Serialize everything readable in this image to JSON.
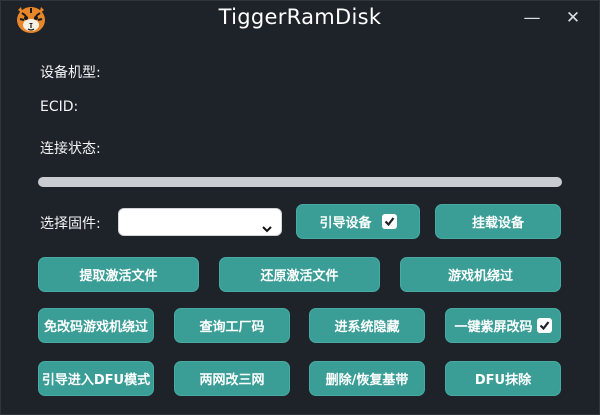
{
  "window": {
    "title": "TiggerRamDisk",
    "minimize_glyph": "—",
    "close_glyph": "✕"
  },
  "device": {
    "model_label": "设备机型:",
    "ecid_label": "ECID:",
    "status_label": "连接状态:"
  },
  "progress": {
    "value": 0
  },
  "firmware": {
    "label": "选择固件:",
    "selected": ""
  },
  "buttons": {
    "boot_device": {
      "label": "引导设备",
      "checked": true
    },
    "mount_device": {
      "label": "挂载设备"
    },
    "extract_activation": {
      "label": "提取激活文件"
    },
    "restore_activation": {
      "label": "还原激活文件"
    },
    "gaming_bypass": {
      "label": "游戏机绕过"
    },
    "no_code_gaming_bypass": {
      "label": "免改码游戏机绕过"
    },
    "query_factory_code": {
      "label": "查询工厂码"
    },
    "system_hide": {
      "label": "进系统隐藏"
    },
    "one_click_purple_screen": {
      "label": "一键紫屏改码",
      "checked": true
    },
    "boot_dfu": {
      "label": "引导进入DFU模式"
    },
    "two_to_three_net": {
      "label": "两网改三网"
    },
    "delete_restore_baseband": {
      "label": "删除/恢复基带"
    },
    "dfu_erase": {
      "label": "DFU抹除"
    }
  },
  "colors": {
    "background": "#1e2329",
    "button": "#3a9e97",
    "text": "#f2f4f6"
  },
  "icons": {
    "logo": "tiger-logo-icon",
    "dropdown": "chevron-down-icon",
    "check": "checkmark-icon"
  }
}
